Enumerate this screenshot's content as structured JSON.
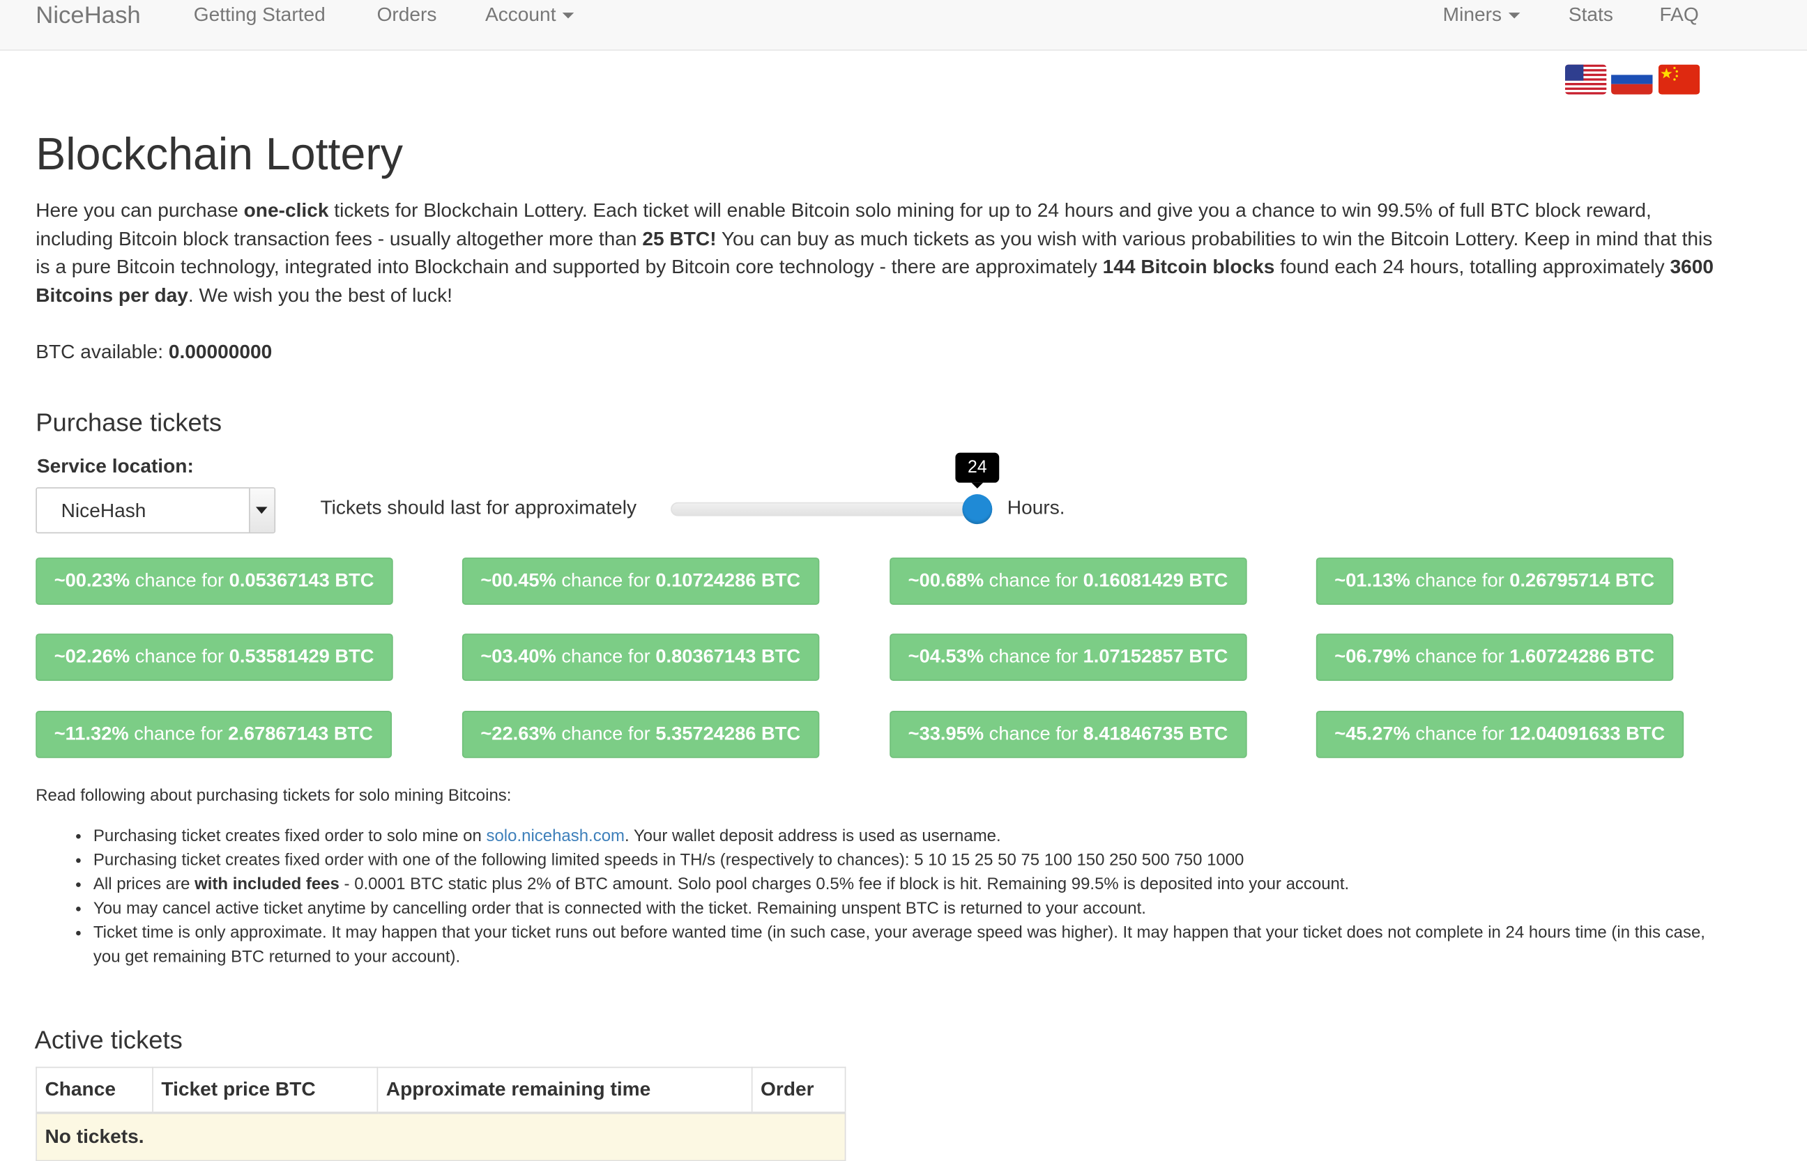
{
  "nav": {
    "brand": "NiceHash",
    "getting_started": "Getting Started",
    "orders": "Orders",
    "account": "Account",
    "miners": "Miners",
    "stats": "Stats",
    "faq": "FAQ"
  },
  "languages": [
    "English (US flag)",
    "Russian flag",
    "Chinese flag"
  ],
  "page_title": "Blockchain Lottery",
  "intro": {
    "p1": "Here you can purchase ",
    "b1": "one-click",
    "p2": " tickets for Blockchain Lottery. Each ticket will enable Bitcoin solo mining for up to 24 hours and give you a chance to win 99.5% of full BTC block reward, including Bitcoin block transaction fees - usually altogether more than ",
    "b2": "25 BTC!",
    "p3": " You can buy as much tickets as you wish with various probabilities to win the Bitcoin Lottery. Keep in mind that this is a pure Bitcoin technology, integrated into Blockchain and supported by Bitcoin core technology - there are approximately ",
    "b3": "144 Bitcoin blocks",
    "p4": " found each 24 hours, totalling approximately ",
    "b4": "3600 Bitcoins per day",
    "p5": ". We wish you the best of luck!"
  },
  "balance": {
    "label": "BTC available: ",
    "value": "0.00000000"
  },
  "purchase": {
    "heading": "Purchase tickets",
    "location_label": "Service location:",
    "location_value": "NiceHash",
    "duration_prefix": "Tickets should last for approximately",
    "duration_value": "24",
    "duration_fraction": 1.0,
    "duration_suffix": "Hours.",
    "chance_word": " chance for ",
    "tickets": [
      {
        "chance": "~00.23%",
        "price": "0.05367143 BTC"
      },
      {
        "chance": "~00.45%",
        "price": "0.10724286 BTC"
      },
      {
        "chance": "~00.68%",
        "price": "0.16081429 BTC"
      },
      {
        "chance": "~01.13%",
        "price": "0.26795714 BTC"
      },
      {
        "chance": "~02.26%",
        "price": "0.53581429 BTC"
      },
      {
        "chance": "~03.40%",
        "price": "0.80367143 BTC"
      },
      {
        "chance": "~04.53%",
        "price": "1.07152857 BTC"
      },
      {
        "chance": "~06.79%",
        "price": "1.60724286 BTC"
      },
      {
        "chance": "~11.32%",
        "price": "2.67867143 BTC"
      },
      {
        "chance": "~22.63%",
        "price": "5.35724286 BTC"
      },
      {
        "chance": "~33.95%",
        "price": "8.41846735 BTC"
      },
      {
        "chance": "~45.27%",
        "price": "12.04091633 BTC"
      }
    ]
  },
  "notes": {
    "intro": "Read following about purchasing tickets for solo mining Bitcoins:",
    "n1_a": "Purchasing ticket creates fixed order to solo mine on ",
    "n1_link": "solo.nicehash.com",
    "n1_b": ". Your wallet deposit address is used as username.",
    "n2": "Purchasing ticket creates fixed order with one of the following limited speeds in TH/s (respectively to chances): 5 10 15 25 50 75 100 150 250 500 750 1000",
    "n3_a": "All prices are ",
    "n3_bold": "with included fees",
    "n3_b": " - 0.0001 BTC static plus 2% of BTC amount. Solo pool charges 0.5% fee if block is hit. Remaining 99.5% is deposited into your account.",
    "n4": "You may cancel active ticket anytime by cancelling order that is connected with the ticket. Remaining unspent BTC is returned to your account.",
    "n5": "Ticket time is only approximate. It may happen that your ticket runs out before wanted time (in such case, your average speed was higher). It may happen that your ticket does not complete in 24 hours time (in this case, you get remaining BTC returned to your account)."
  },
  "active": {
    "heading": "Active tickets",
    "columns": [
      "Chance",
      "Ticket price BTC",
      "Approximate remaining time",
      "Order"
    ],
    "empty": "No tickets."
  },
  "colors": {
    "button_green": "#7ccd86",
    "slider_blue": "#1f8ad6",
    "link_blue": "#3d7fba",
    "empty_row": "#fcf8e3"
  }
}
